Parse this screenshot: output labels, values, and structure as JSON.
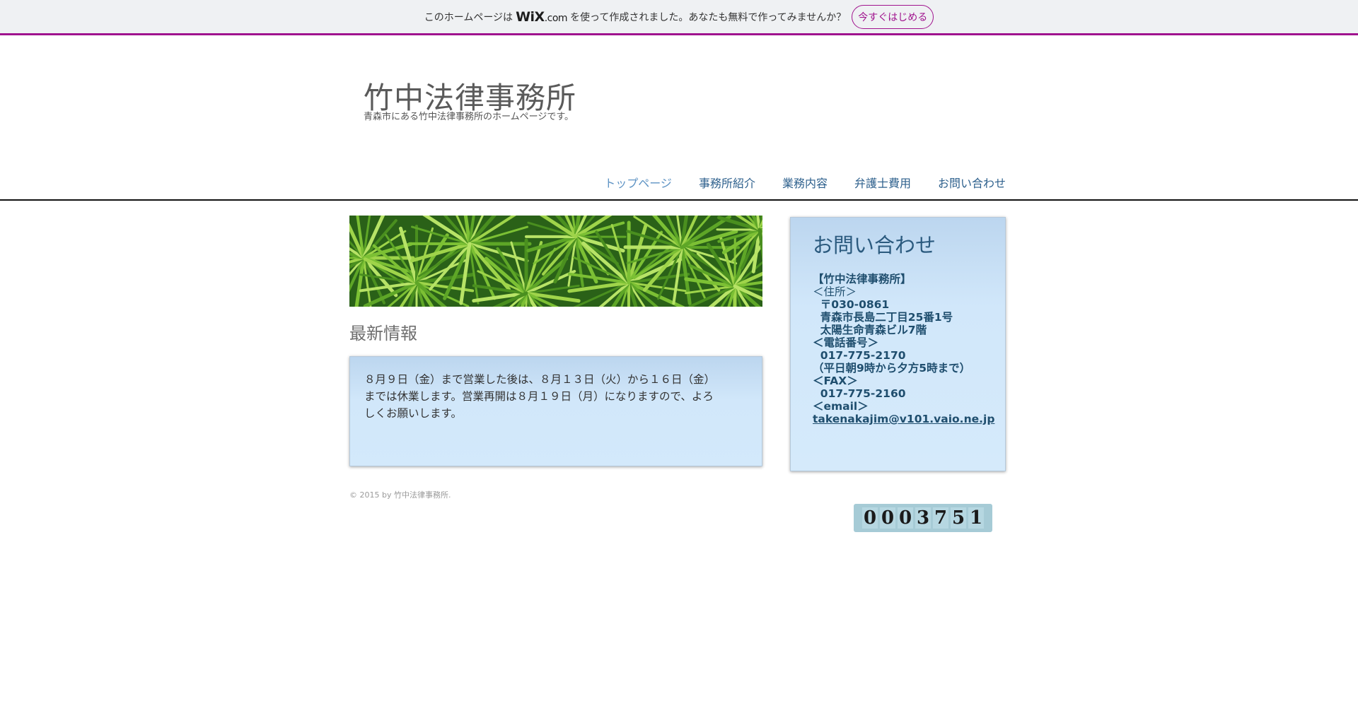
{
  "wix_banner": {
    "text_before": "このホームページは",
    "logo_main": "WiX",
    "logo_suffix": ".com",
    "text_after": "を使って作成されました。あなたも無料で作ってみませんか？",
    "button_label": "今すぐはじめる",
    "accent_color": "#a0138e"
  },
  "header": {
    "title": "竹中法律事務所",
    "subtitle": "青森市にある竹中法律事務所のホームページです。"
  },
  "nav": {
    "items": [
      {
        "label": "トップページ",
        "active": true
      },
      {
        "label": "事務所紹介"
      },
      {
        "label": "業務内容"
      },
      {
        "label": "弁護士費用"
      },
      {
        "label": "お問い合わせ"
      }
    ]
  },
  "news": {
    "title": "最新情報",
    "body": "８月９日（金）まで営業した後は、８月１３日（火）から１６日（金）までは休業します。営業再開は８月１９日（月）になりますので、よろしくお願いします。"
  },
  "footer": {
    "copyright": "© 2015 by 竹中法律事務所."
  },
  "contact": {
    "title": "お問い合わせ",
    "office": "【竹中法律事務所】",
    "address_label": "＜住所＞",
    "postal": "  〒030-0861",
    "address1": "  青森市長島二丁目25番1号",
    "address2": "  太陽生命青森ビル7階",
    "phone_label": "＜電話番号＞",
    "phone": "  017-775-2170",
    "phone_hours": "（平日朝9時から夕方5時まで）",
    "fax_label": "＜FAX＞",
    "fax": "  017-775-2160",
    "email_label": "＜email＞",
    "email": "takenakajim@v101.vaio.ne.jp"
  },
  "counter": {
    "digits": [
      "0",
      "0",
      "0",
      "3",
      "7",
      "5",
      "1"
    ]
  }
}
